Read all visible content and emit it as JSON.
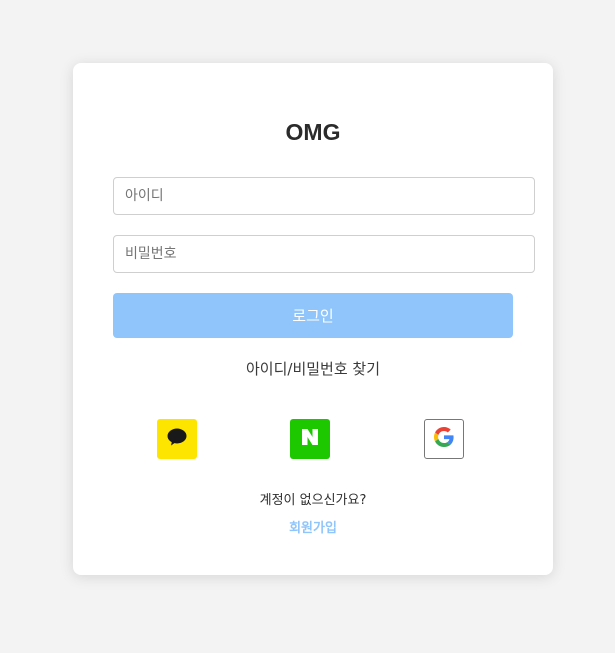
{
  "app": {
    "title": "OMG"
  },
  "form": {
    "id_placeholder": "아이디",
    "password_placeholder": "비밀번호",
    "login_label": "로그인",
    "find_account_label": "아이디/비밀번호 찾기"
  },
  "social_login": [
    {
      "provider": "kakao",
      "icon": "kakao-speech-bubble-icon",
      "color": "#fee500"
    },
    {
      "provider": "naver",
      "icon": "naver-n-icon",
      "color": "#1ec800"
    },
    {
      "provider": "google",
      "icon": "google-g-icon",
      "color": "#ffffff"
    }
  ],
  "signup": {
    "question": "계정이 없으신가요?",
    "link_label": "회원가입"
  },
  "colors": {
    "background": "#f3f3f3",
    "card": "#ffffff",
    "primary": "#90c5fb"
  }
}
